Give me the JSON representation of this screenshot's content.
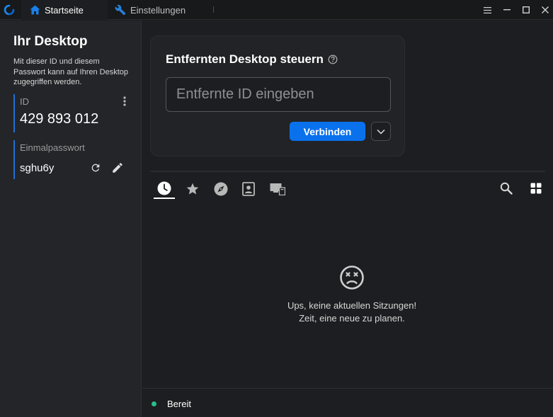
{
  "colors": {
    "accent": "#0a71ed",
    "status_ok": "#27c08a",
    "background": "#1d1e21",
    "sidebar": "#242529"
  },
  "titlebar": {
    "tabs": [
      {
        "label": "Startseite",
        "icon": "home-icon",
        "active": true
      },
      {
        "label": "Einstellungen",
        "icon": "wrench-icon",
        "active": false
      }
    ],
    "window_controls": [
      "menu-icon",
      "minimize-icon",
      "maximize-icon",
      "close-icon"
    ]
  },
  "sidebar": {
    "title": "Ihr Desktop",
    "description": "Mit dieser ID und diesem Passwort kann auf Ihren Desktop zugegriffen werden.",
    "id_label": "ID",
    "id_value": "429 893 012",
    "password_label": "Einmalpasswort",
    "password_value": "sghu6y"
  },
  "connect": {
    "title": "Entfernten Desktop steuern",
    "input_placeholder": "Entfernte ID eingeben",
    "connect_label": "Verbinden"
  },
  "session_tabs": [
    {
      "name": "recent",
      "icon": "clock-icon",
      "active": true
    },
    {
      "name": "favorites",
      "icon": "star-icon",
      "active": false
    },
    {
      "name": "discovered",
      "icon": "compass-icon",
      "active": false
    },
    {
      "name": "address-book",
      "icon": "address-book-icon",
      "active": false
    },
    {
      "name": "lan",
      "icon": "lan-devices-icon",
      "active": false
    }
  ],
  "empty_state": {
    "icon": "dizzy-face-icon",
    "line1": "Ups, keine aktuellen Sitzungen!",
    "line2": "Zeit, eine neue zu planen."
  },
  "status": {
    "text": "Bereit"
  }
}
